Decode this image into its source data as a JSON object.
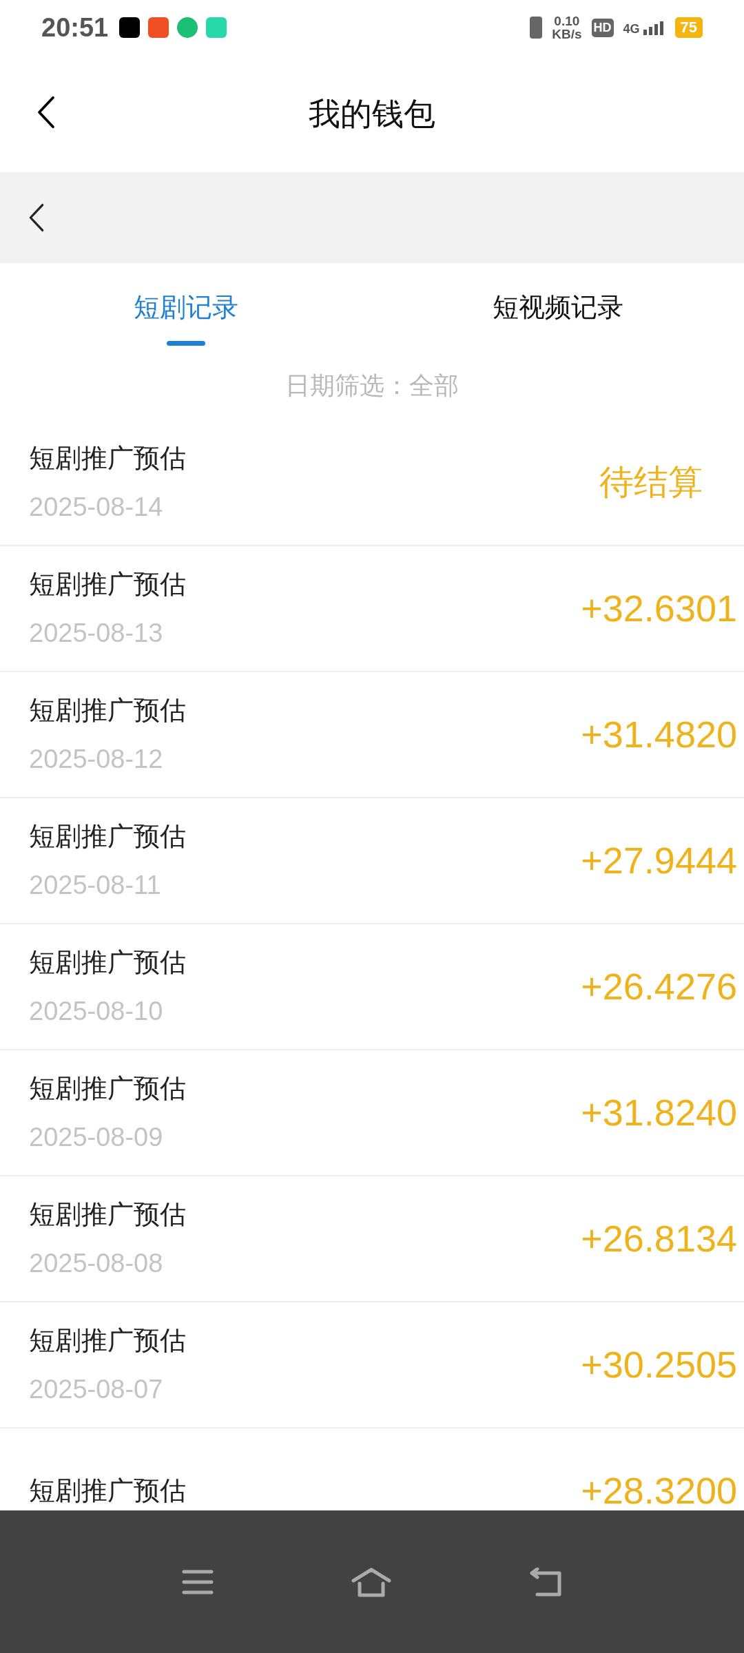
{
  "status_bar": {
    "time": "20:51",
    "speed_value": "0.10",
    "speed_unit": "KB/s",
    "hd": "HD",
    "network": "4G",
    "battery": "75"
  },
  "header": {
    "title": "我的钱包"
  },
  "tabs": [
    {
      "label": "短剧记录",
      "selected": true
    },
    {
      "label": "短视频记录",
      "selected": false
    }
  ],
  "filter": {
    "label": "日期筛选：全部"
  },
  "records": [
    {
      "title": "短剧推广预估",
      "date": "2025-08-14",
      "kind": "pending",
      "amount": "待结算"
    },
    {
      "title": "短剧推广预估",
      "date": "2025-08-13",
      "kind": "amount",
      "amount": "+32.6301"
    },
    {
      "title": "短剧推广预估",
      "date": "2025-08-12",
      "kind": "amount",
      "amount": "+31.4820"
    },
    {
      "title": "短剧推广预估",
      "date": "2025-08-11",
      "kind": "amount",
      "amount": "+27.9444"
    },
    {
      "title": "短剧推广预估",
      "date": "2025-08-10",
      "kind": "amount",
      "amount": "+26.4276"
    },
    {
      "title": "短剧推广预估",
      "date": "2025-08-09",
      "kind": "amount",
      "amount": "+31.8240"
    },
    {
      "title": "短剧推广预估",
      "date": "2025-08-08",
      "kind": "amount",
      "amount": "+26.8134"
    },
    {
      "title": "短剧推广预估",
      "date": "2025-08-07",
      "kind": "amount",
      "amount": "+30.2505"
    },
    {
      "title": "短剧推广预估",
      "kind": "amount",
      "amount": "+28.3200"
    }
  ]
}
